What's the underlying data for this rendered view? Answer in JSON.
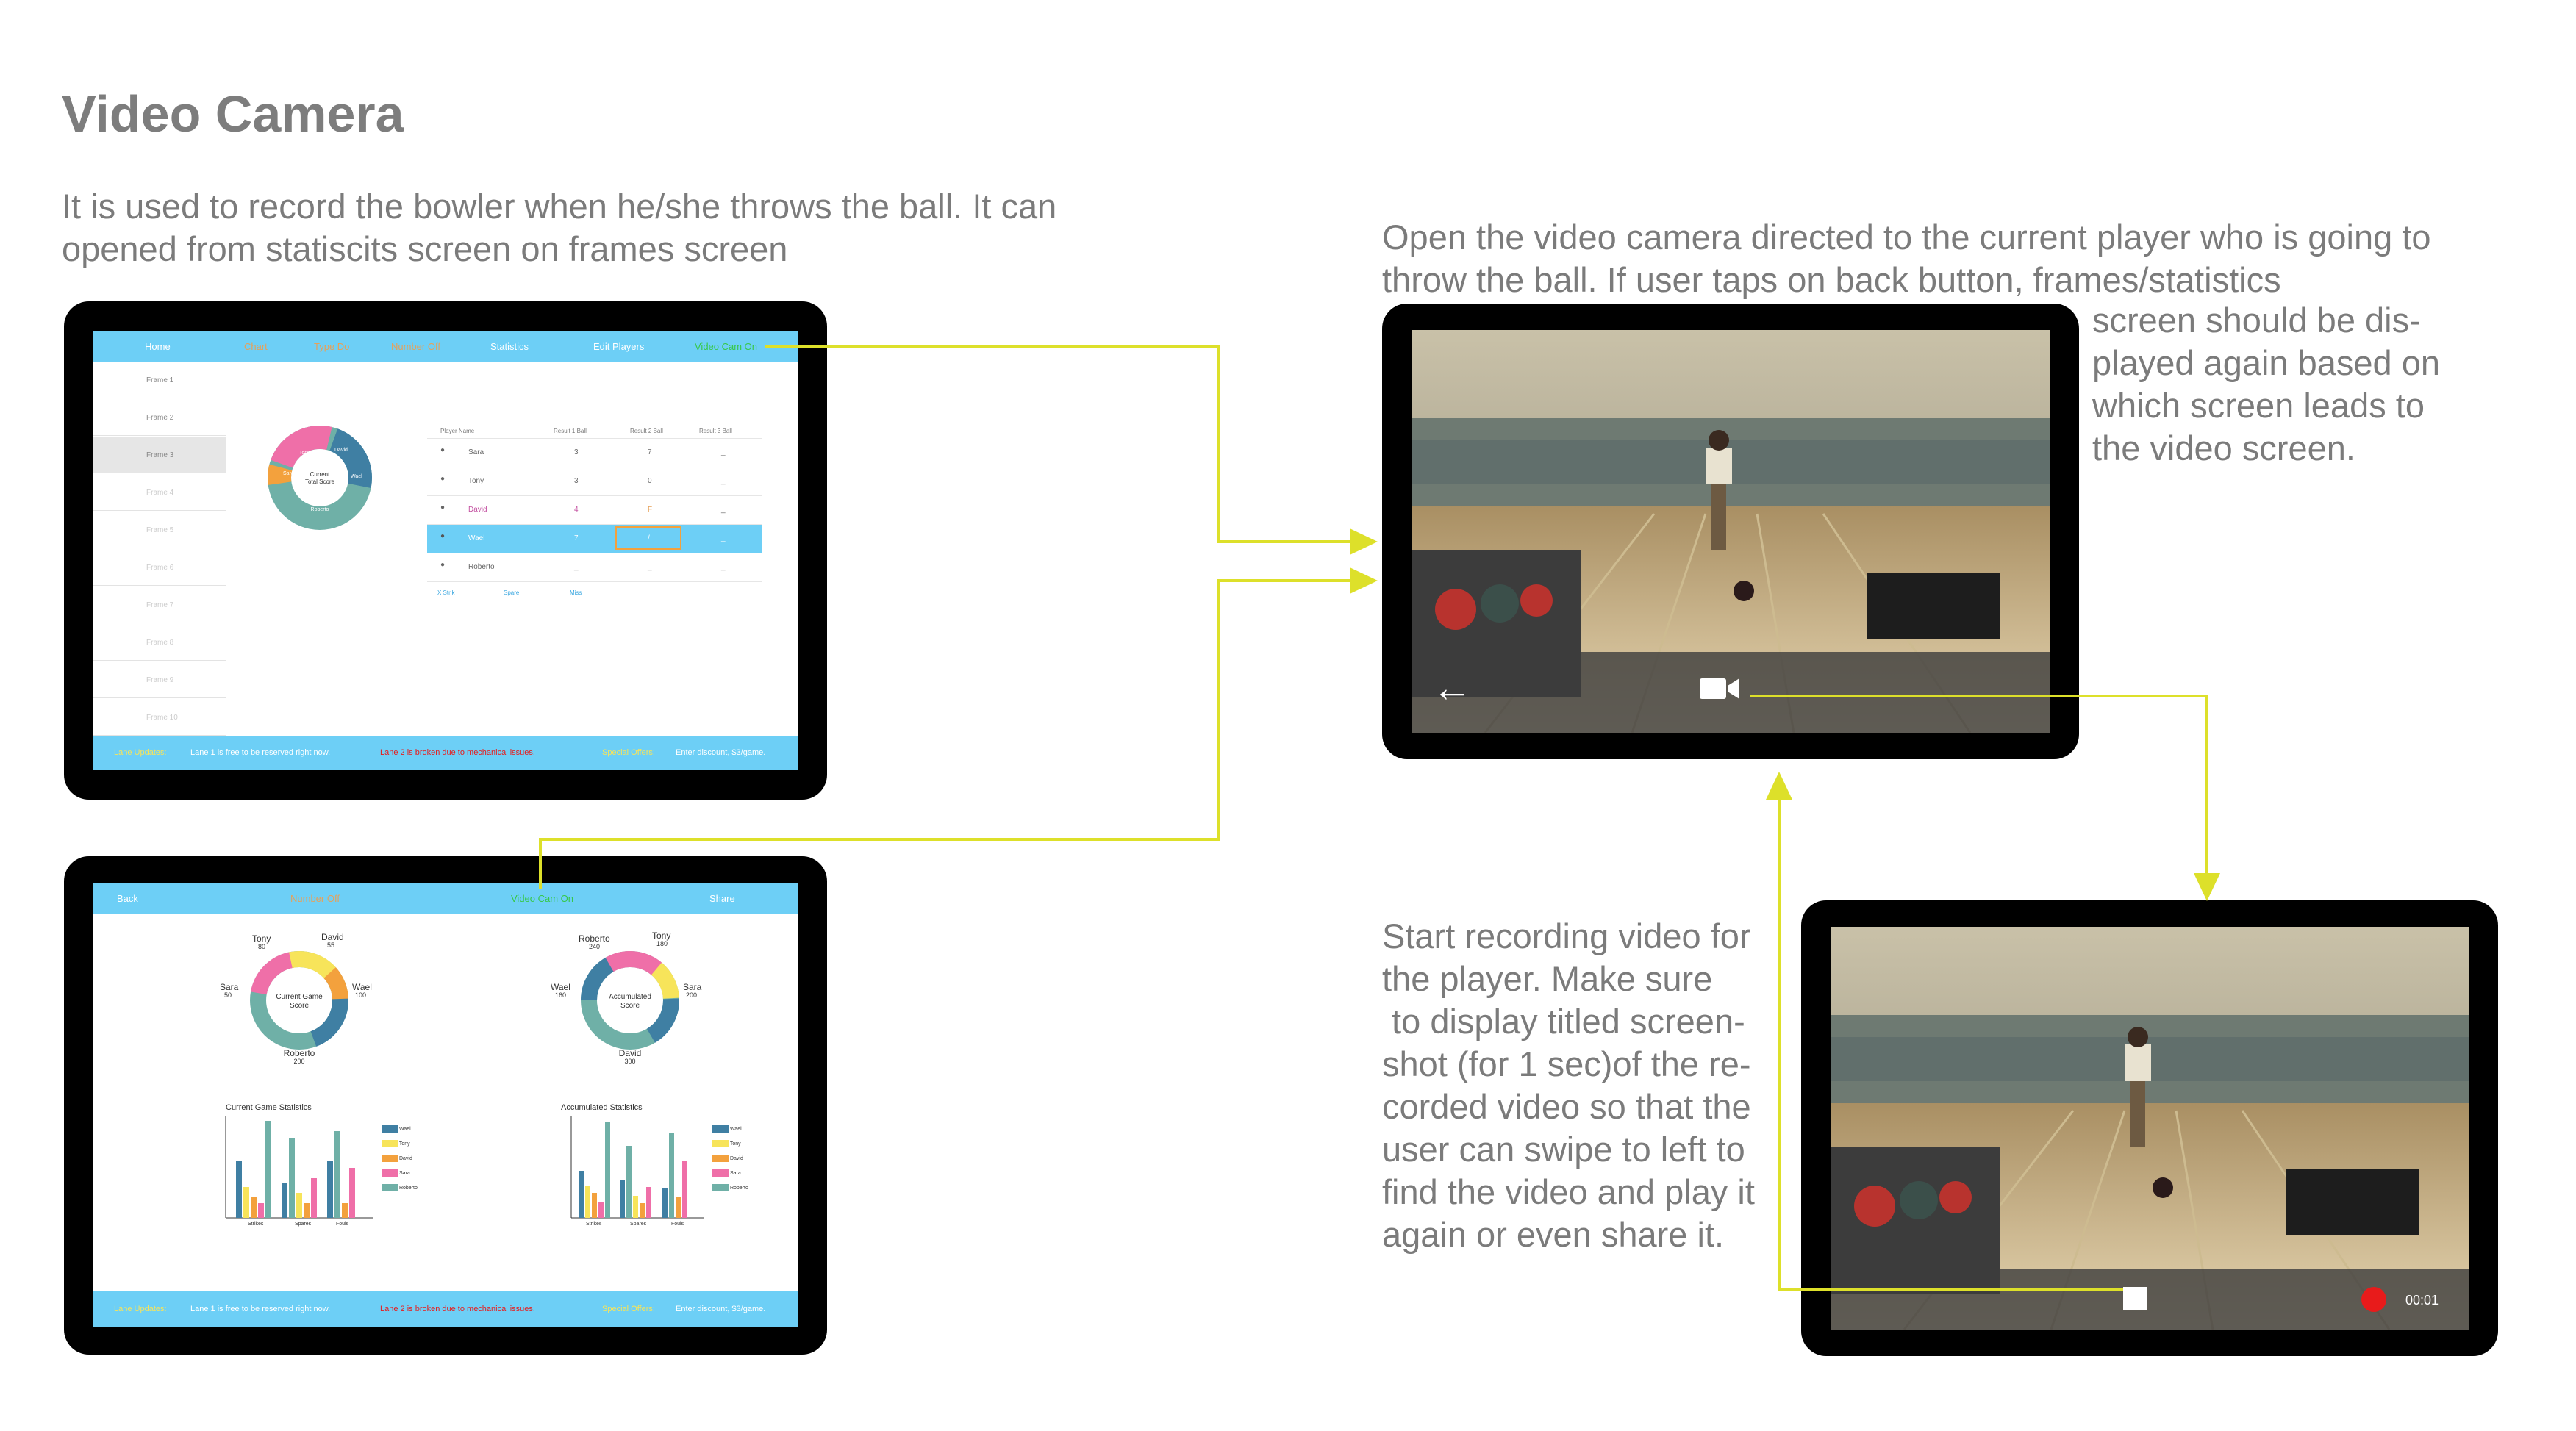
{
  "heading": "Video Camera",
  "intro": [
    "It is used to record the bowler when he/she throws the ball. It can",
    "opened from statiscits screen on frames screen"
  ],
  "note_open": [
    "Open the video camera directed to the current player who is going to",
    "throw the ball. If user taps on back button, frames/statistics",
    "screen should be dis-",
    "played again based on",
    "which screen leads to",
    "the video screen."
  ],
  "note_record": [
    "Start recording video for",
    "the player. Make sure",
    " to display titled screen-",
    "shot (for 1 sec)of the re-",
    "corded video so that the",
    "user can swipe to left to",
    "find the video and play it",
    "again or even share it."
  ],
  "frames_screen": {
    "nav": [
      "Home",
      "Chart",
      "Type Do",
      "Number Off",
      "Statistics",
      "Edit Players",
      "Video Cam On"
    ],
    "frames": [
      "Frame 1",
      "Frame 2",
      "Frame 3",
      "Frame 4",
      "Frame 5",
      "Frame 6",
      "Frame 7",
      "Frame 8",
      "Frame 9",
      "Frame 10"
    ],
    "donut_center": [
      "Current",
      "Total Score"
    ],
    "donut_labels": [
      "Tony",
      "David",
      "Sara",
      "Wael",
      "Roberto"
    ],
    "table_headers": [
      "Player Name",
      "Result 1 Ball",
      "Result 2 Ball",
      "Result 3 Ball"
    ],
    "rows": [
      {
        "name": "Sara",
        "c1": "3",
        "c2": "7",
        "c3": "_"
      },
      {
        "name": "Tony",
        "c1": "3",
        "c2": "0",
        "c3": "_"
      },
      {
        "name": "David",
        "c1": "4",
        "c2": "F",
        "c3": "_"
      },
      {
        "name": "Wael",
        "c1": "7",
        "c2": "/",
        "c3": "_"
      },
      {
        "name": "Roberto",
        "c1": "_",
        "c2": "_",
        "c3": "_"
      }
    ],
    "table_footer": [
      "X Strik",
      "Spare",
      "Miss"
    ],
    "footer": {
      "label": "Lane Updates:",
      "free": "Lane 1 is free to be reserved right now.",
      "broken": "Lane 2 is broken due to mechanical issues.",
      "offer_label": "Special Offers:",
      "offer": "Enter  discount, $3/game."
    }
  },
  "stats_screen": {
    "nav": [
      "Back",
      "Number Off",
      "Video Cam On",
      "Share"
    ],
    "donut1": {
      "center": [
        "Current Game",
        "Score"
      ],
      "labels": [
        [
          "Tony",
          "80"
        ],
        [
          "David",
          "55"
        ],
        [
          "Sara",
          "50"
        ],
        [
          "Wael",
          "100"
        ],
        [
          "Roberto",
          "200"
        ]
      ]
    },
    "donut2": {
      "center": [
        "Accumulated",
        "Score"
      ],
      "labels": [
        [
          "Roberto",
          "240"
        ],
        [
          "Tony",
          "180"
        ],
        [
          "Wael",
          "160"
        ],
        [
          "Sara",
          "200"
        ],
        [
          "David",
          "300"
        ]
      ]
    },
    "chart1_title": "Current Game Statistics",
    "chart2_title": "Accumulated Statistics",
    "legend": [
      "Wael",
      "Tony",
      "David",
      "Sara",
      "Roberto"
    ],
    "categories": [
      "Strikes",
      "Spares",
      "Fouls"
    ],
    "colors": {
      "wael": "#3f7fa3",
      "tony": "#f7e45a",
      "david": "#f3a13d",
      "sara": "#ef6fa8",
      "roberto": "#6fb0a7"
    }
  },
  "video": {
    "timer": "00:01"
  },
  "colors": {
    "accent": "#dde02a",
    "nav": "#6dcff6",
    "record": "#e81b1b"
  }
}
